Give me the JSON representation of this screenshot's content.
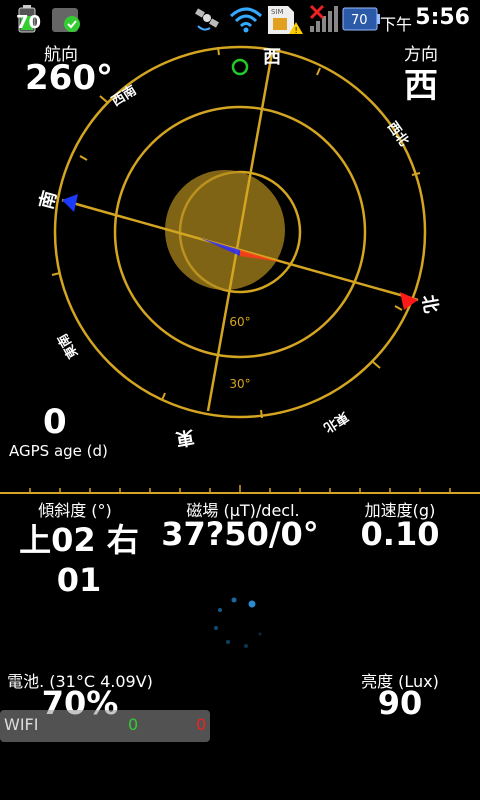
{
  "status_bar": {
    "battery_level": "70",
    "battery_right_level": "70",
    "ampm": "下午",
    "time": "5:56",
    "icons": [
      "battery-icon",
      "app-icon",
      "satellite-icon",
      "wifi-icon",
      "sim-warning-icon",
      "no-signal-icon",
      "battery-icon",
      "clock"
    ]
  },
  "heading": {
    "label": "航向",
    "value": "260°"
  },
  "direction": {
    "label": "方向",
    "value": "西"
  },
  "compass": {
    "labels": {
      "west": "西",
      "south": "南",
      "north": "北",
      "east": "東",
      "southwest": "西南",
      "northwest": "西北",
      "southeast": "東南",
      "northeast": "東北"
    },
    "ring_60": "60°",
    "ring_30": "30°",
    "colors": {
      "ring": "#d4a520",
      "north_arrow": "#ff1a1a",
      "south_arrow": "#1a3aff",
      "gps_dot": "#22cc22"
    }
  },
  "agps": {
    "value": "0",
    "label": "AGPS age (d)"
  },
  "tilt": {
    "label": "傾斜度 (°)",
    "value": "上02 右01"
  },
  "magnetic": {
    "label": "磁場 (µT)/decl.",
    "value": "37?50/0°"
  },
  "acceleration": {
    "label": "加速度(g)",
    "value": "0.10"
  },
  "battery": {
    "label": "電池. (31°C 4.09V)",
    "value": "70%"
  },
  "lux": {
    "label": "亮度 (Lux)",
    "value": "90"
  },
  "wifi": {
    "label": "WIFI",
    "green": "0",
    "red": "0"
  }
}
